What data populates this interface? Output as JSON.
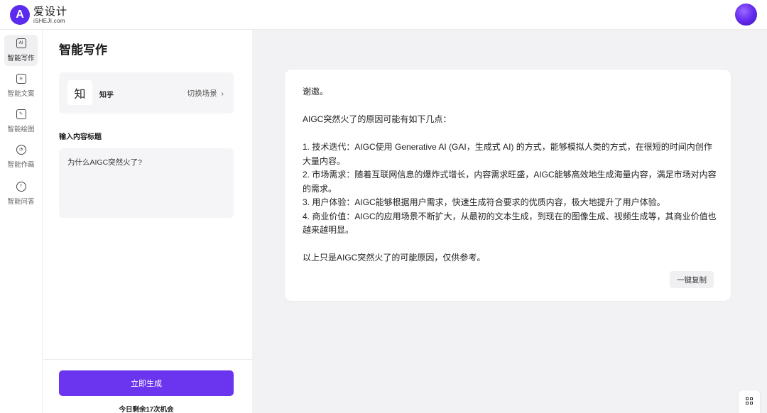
{
  "brand": {
    "mark": "A",
    "title": "爱设计",
    "subtitle": "iSHEJI.com"
  },
  "sidebar": {
    "items": [
      {
        "label": "智能写作",
        "icon": "ai-write-icon",
        "icon_glyph": "AI",
        "active": true
      },
      {
        "label": "智能文案",
        "icon": "ai-copy-icon",
        "icon_glyph": "≡",
        "active": false
      },
      {
        "label": "智能绘图",
        "icon": "ai-draw-icon",
        "icon_glyph": "✎",
        "active": false
      },
      {
        "label": "智能作画",
        "icon": "ai-paint-icon",
        "icon_glyph": "◔",
        "active": false
      },
      {
        "label": "智能问答",
        "icon": "help-circle-icon",
        "icon_glyph": "?",
        "active": false
      }
    ]
  },
  "panel": {
    "title": "智能写作",
    "scene": {
      "icon_text": "知",
      "name": "知乎",
      "switch_label": "切换场景",
      "chevron": "›"
    },
    "field_label": "输入内容标题",
    "input_value": "为什么AIGC突然火了?",
    "generate_label": "立即生成",
    "quota_text": "今日剩余17次机会"
  },
  "result": {
    "lines": [
      "谢邀。",
      "",
      "AIGC突然火了的原因可能有如下几点：",
      "",
      "1. 技术迭代：AIGC使用 Generative AI (GAI，生成式 AI) 的方式，能够模拟人类的方式，在很短的时间内创作大量内容。",
      "2. 市场需求：随着互联网信息的爆炸式增长，内容需求旺盛，AIGC能够高效地生成海量内容，满足市场对内容的需求。",
      "3. 用户体验：AIGC能够根据用户需求，快速生成符合要求的优质内容，极大地提升了用户体验。",
      "4. 商业价值：AIGC的应用场景不断扩大，从最初的文本生成，到现在的图像生成、视频生成等，其商业价值也越来越明显。",
      "",
      "以上只是AIGC突然火了的可能原因，仅供参考。"
    ],
    "copy_label": "一键复制"
  },
  "float_tools": {
    "help_glyph": "?"
  },
  "colors": {
    "accent": "#6b35f0",
    "brand": "#5b2cf0",
    "panel_bg": "#f5f5f7",
    "main_bg": "#f2f2f4"
  }
}
